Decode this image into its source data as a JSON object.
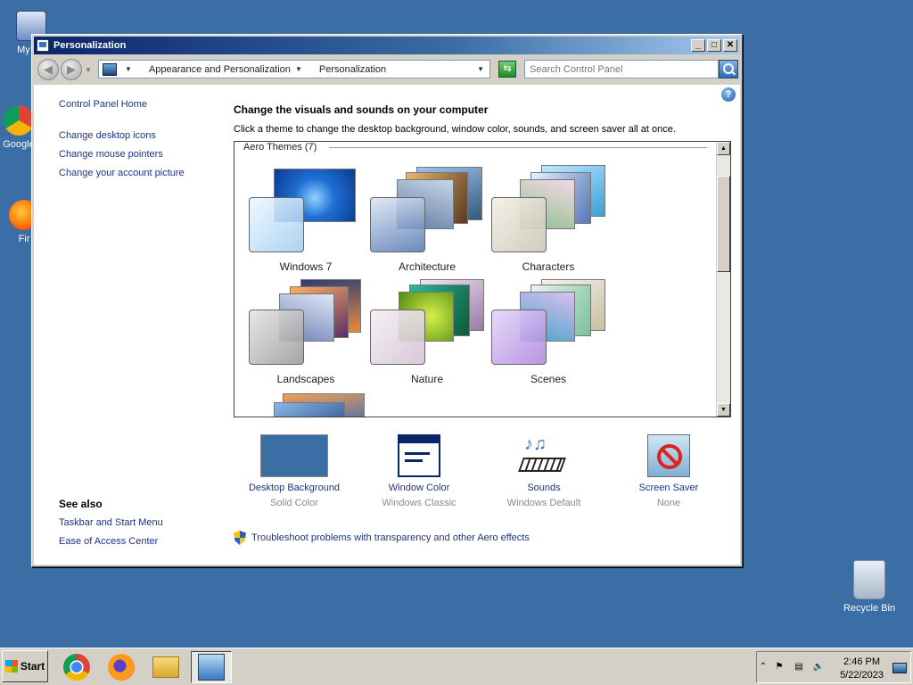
{
  "desktop": {
    "icons": [
      {
        "label": "My Co"
      },
      {
        "label": "Google"
      },
      {
        "label": "Fir"
      },
      {
        "label": "Recycle Bin"
      }
    ]
  },
  "window": {
    "title": "Personalization",
    "controls": {
      "minimize": "_",
      "maximize": "□",
      "close": "✕"
    }
  },
  "address": {
    "crumbs": [
      "Appearance and Personalization",
      "Personalization"
    ],
    "search_placeholder": "Search Control Panel"
  },
  "help_label": "?",
  "leftnav": {
    "home": "Control Panel Home",
    "links": [
      "Change desktop icons",
      "Change mouse pointers",
      "Change your account picture"
    ],
    "see_also_title": "See also",
    "see_also": [
      "Taskbar and Start Menu",
      "Ease of Access Center"
    ]
  },
  "main": {
    "title": "Change the visuals and sounds on your computer",
    "subtitle": "Click a theme to change the desktop background, window color, sounds, and screen saver all at once.",
    "group_label": "Aero Themes (7)",
    "themes": [
      {
        "label": "Windows 7",
        "accent": "#1e6fd6"
      },
      {
        "label": "Architecture",
        "accent": "#8a6a3a"
      },
      {
        "label": "Characters",
        "accent": "#4fa8d8"
      },
      {
        "label": "Landscapes",
        "accent": "#c56a2a"
      },
      {
        "label": "Nature",
        "accent": "#6dbb2a"
      },
      {
        "label": "Scenes",
        "accent": "#b47ad2"
      }
    ]
  },
  "bottom": [
    {
      "label": "Desktop Background",
      "sub": "Solid Color"
    },
    {
      "label": "Window Color",
      "sub": "Windows Classic"
    },
    {
      "label": "Sounds",
      "sub": "Windows Default"
    },
    {
      "label": "Screen Saver",
      "sub": "None"
    }
  ],
  "troubleshoot": "Troubleshoot problems with transparency and other Aero effects",
  "taskbar": {
    "start_label": "Start",
    "time": "2:46 PM",
    "date": "5/22/2023"
  }
}
